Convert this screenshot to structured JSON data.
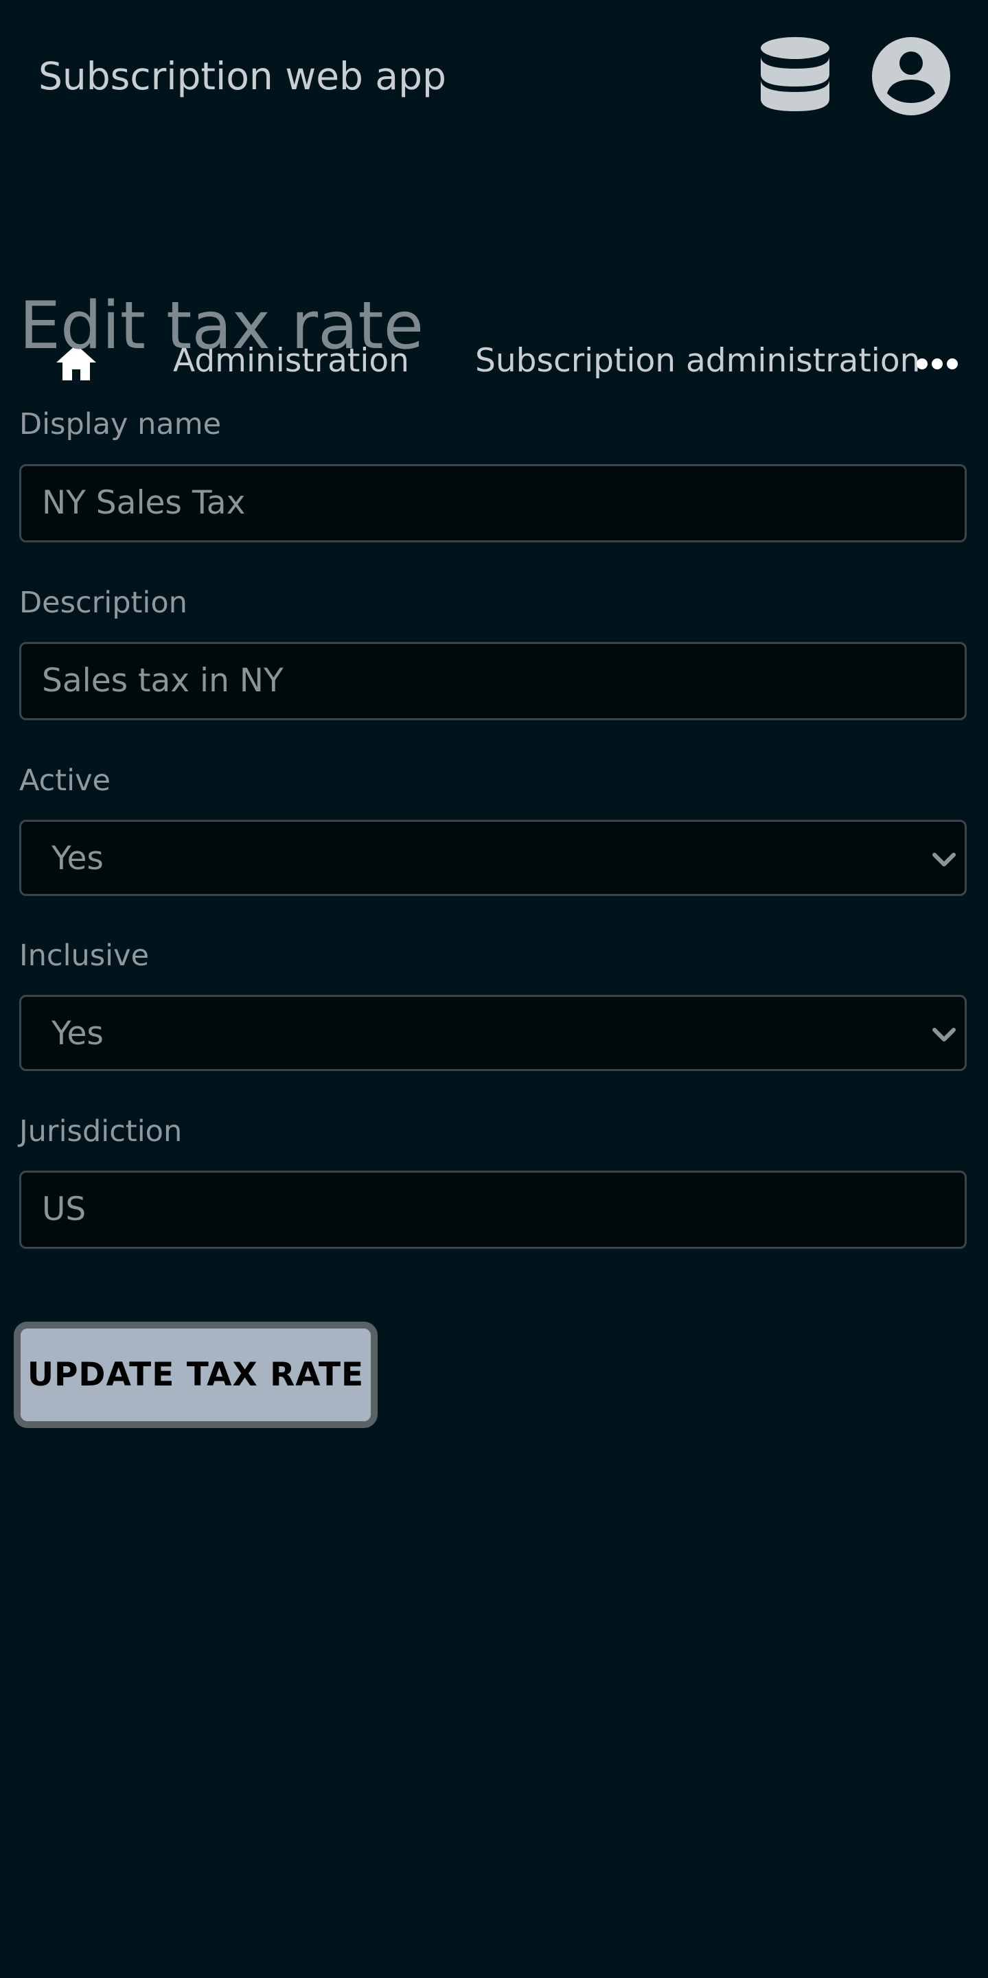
{
  "header": {
    "app_title": "Subscription web app",
    "database_icon": "database-icon",
    "account_icon": "account-circle-icon"
  },
  "breadcrumb": {
    "home_icon": "home-icon",
    "items": [
      {
        "label": "Administration"
      },
      {
        "label": "Subscription administration"
      }
    ],
    "more_icon": "more-horizontal-icon"
  },
  "form": {
    "title": "Edit tax rate",
    "fields": {
      "display_name": {
        "label": "Display name",
        "value": "NY Sales Tax"
      },
      "description": {
        "label": "Description",
        "value": "Sales tax in NY"
      },
      "active": {
        "label": "Active",
        "value": "Yes"
      },
      "inclusive": {
        "label": "Inclusive",
        "value": "Yes"
      },
      "jurisdiction": {
        "label": "Jurisdiction",
        "value": "US"
      }
    },
    "submit_label": "UPDATE TAX RATE"
  },
  "colors": {
    "background": "#02141b",
    "input_background": "#02090d",
    "button_background": "#a8b4c2",
    "text_primary": "#c8ced2",
    "text_muted": "#8f999e"
  }
}
